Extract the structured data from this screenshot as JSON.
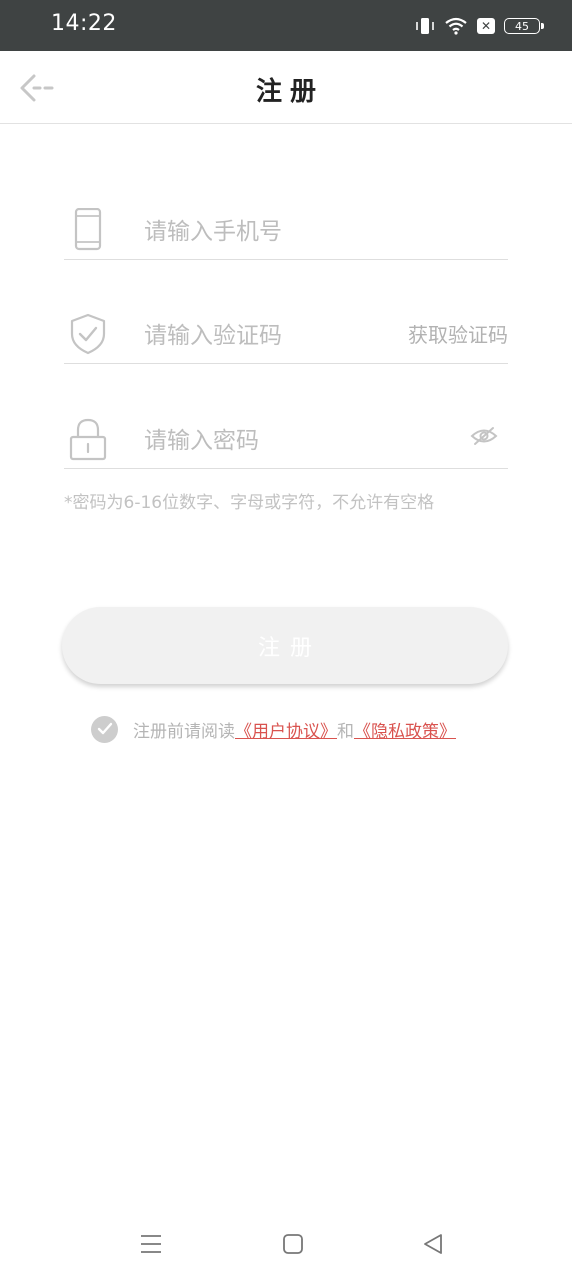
{
  "status_bar": {
    "time": "14:22",
    "battery": "45",
    "icons": [
      "vibrate-icon",
      "wifi-icon",
      "close-box-icon",
      "battery-icon"
    ]
  },
  "header": {
    "title": "注册",
    "back_icon": "back-arrow-icon"
  },
  "form": {
    "phone": {
      "placeholder": "请输入手机号",
      "icon": "phone-icon"
    },
    "code": {
      "placeholder": "请输入验证码",
      "icon": "shield-check-icon",
      "get_code_label": "获取验证码"
    },
    "password": {
      "placeholder": "请输入密码",
      "icon": "lock-icon",
      "toggle_icon": "eye-hidden-icon"
    },
    "hint": "*密码为6-16位数字、字母或字符，不允许有空格"
  },
  "register_button": {
    "label": "注册"
  },
  "agreement": {
    "prefix": "注册前请阅读",
    "user_agreement": "《用户协议》",
    "and": "和",
    "privacy_policy": "《隐私政策》"
  },
  "nav_bar": {
    "icons": [
      "menu-icon",
      "home-icon",
      "back-triangle-icon"
    ]
  },
  "colors": {
    "status_bar_bg": "#3f4343",
    "link": "#d9534f",
    "placeholder": "#bdbdbd"
  }
}
